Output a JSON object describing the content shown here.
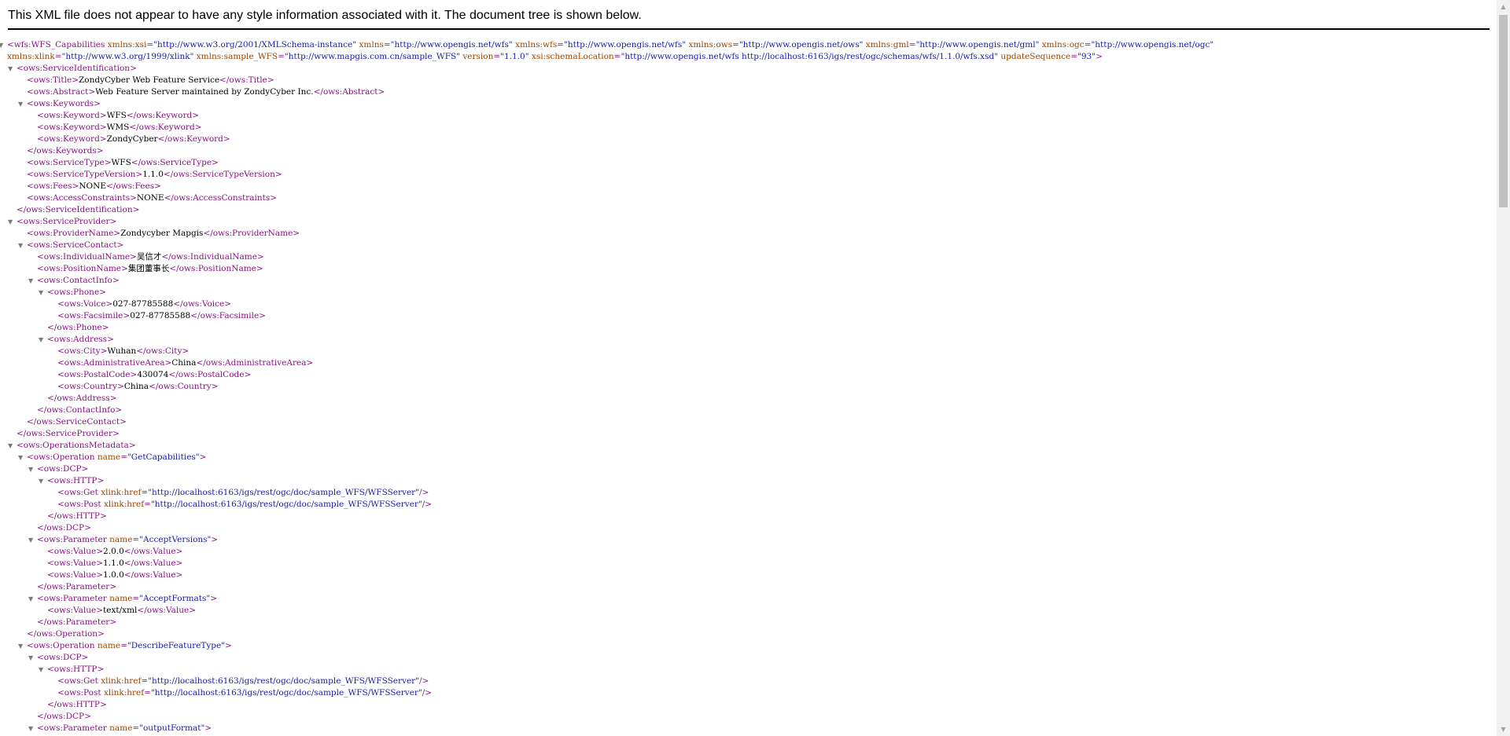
{
  "banner": {
    "text": "This XML file does not appear to have any style information associated with it. The document tree is shown below."
  },
  "icons": {
    "expand": "triangle-down-icon",
    "scroll_up": "scroll-up-arrow-icon",
    "scroll_down": "scroll-down-arrow-icon"
  },
  "scroll": {
    "position_fraction": 0.0
  },
  "colors": {
    "tag": "#881280",
    "attribute_name": "#994500",
    "attribute_value": "#1a1aa6",
    "text": "#000000"
  },
  "tree": {
    "root": {
      "open_tag": "<wfs:WFS_Capabilities",
      "attrs_line1": [
        {
          "name": "xmlns:xsi",
          "value": "\"http://www.w3.org/2001/XMLSchema-instance\""
        },
        {
          "name": "xmlns",
          "value": "\"http://www.opengis.net/wfs\""
        },
        {
          "name": "xmlns:wfs",
          "value": "\"http://www.opengis.net/wfs\""
        },
        {
          "name": "xmlns:ows",
          "value": "\"http://www.opengis.net/ows\""
        },
        {
          "name": "xmlns:gml",
          "value": "\"http://www.opengis.net/gml\""
        },
        {
          "name": "xmlns:ogc",
          "value": "\"http://www.opengis.net/ogc\""
        }
      ],
      "attrs_line2": [
        {
          "name": "xmlns:xlink",
          "value": "\"http://www.w3.org/1999/xlink\""
        },
        {
          "name": "xmlns:sample_WFS",
          "value": "\"http://www.mapgis.com.cn/sample_WFS\""
        },
        {
          "name": "version",
          "value": "\"1.1.0\""
        },
        {
          "name": "xsi:schemaLocation",
          "value": "\"http://www.opengis.net/wfs http://localhost:6163/igs/rest/ogc/schemas/wfs/1.1.0/wfs.xsd\""
        },
        {
          "name": "updateSequence",
          "value": "\"93\""
        }
      ],
      "close_bracket": ">"
    },
    "service_identification": {
      "open": "<ows:ServiceIdentification>",
      "title": {
        "open": "<ows:Title>",
        "value": "ZondyCyber Web Feature Service",
        "close": "</ows:Title>"
      },
      "abstract": {
        "open": "<ows:Abstract>",
        "value": "Web Feature Server maintained by ZondyCyber Inc.",
        "close": "</ows:Abstract>"
      },
      "keywords_open": "<ows:Keywords>",
      "keywords": [
        {
          "open": "<ows:Keyword>",
          "value": "WFS",
          "close": "</ows:Keyword>"
        },
        {
          "open": "<ows:Keyword>",
          "value": "WMS",
          "close": "</ows:Keyword>"
        },
        {
          "open": "<ows:Keyword>",
          "value": "ZondyCyber",
          "close": "</ows:Keyword>"
        }
      ],
      "keywords_close": "</ows:Keywords>",
      "service_type": {
        "open": "<ows:ServiceType>",
        "value": "WFS",
        "close": "</ows:ServiceType>"
      },
      "service_type_version": {
        "open": "<ows:ServiceTypeVersion>",
        "value": "1.1.0",
        "close": "</ows:ServiceTypeVersion>"
      },
      "fees": {
        "open": "<ows:Fees>",
        "value": "NONE",
        "close": "</ows:Fees>"
      },
      "access_constraints": {
        "open": "<ows:AccessConstraints>",
        "value": "NONE",
        "close": "</ows:AccessConstraints>"
      },
      "close": "</ows:ServiceIdentification>"
    },
    "service_provider": {
      "open": "<ows:ServiceProvider>",
      "provider_name": {
        "open": "<ows:ProviderName>",
        "value": "Zondycyber Mapgis",
        "close": "</ows:ProviderName>"
      },
      "service_contact_open": "<ows:ServiceContact>",
      "individual_name": {
        "open": "<ows:IndividualName>",
        "value": "吴信才",
        "close": "</ows:IndividualName>"
      },
      "position_name": {
        "open": "<ows:PositionName>",
        "value": "集团董事长",
        "close": "</ows:PositionName>"
      },
      "contact_info_open": "<ows:ContactInfo>",
      "phone_open": "<ows:Phone>",
      "voice": {
        "open": "<ows:Voice>",
        "value": "027-87785588",
        "close": "</ows:Voice>"
      },
      "facsimile": {
        "open": "<ows:Facsimile>",
        "value": "027-87785588",
        "close": "</ows:Facsimile>"
      },
      "phone_close": "</ows:Phone>",
      "address_open": "<ows:Address>",
      "city": {
        "open": "<ows:City>",
        "value": "Wuhan",
        "close": "</ows:City>"
      },
      "administrative_area": {
        "open": "<ows:AdministrativeArea>",
        "value": "China",
        "close": "</ows:AdministrativeArea>"
      },
      "postal_code": {
        "open": "<ows:PostalCode>",
        "value": "430074",
        "close": "</ows:PostalCode>"
      },
      "country": {
        "open": "<ows:Country>",
        "value": "China",
        "close": "</ows:Country>"
      },
      "address_close": "</ows:Address>",
      "contact_info_close": "</ows:ContactInfo>",
      "service_contact_close": "</ows:ServiceContact>",
      "close": "</ows:ServiceProvider>"
    },
    "operations_metadata": {
      "open": "<ows:OperationsMetadata>",
      "op_open_prefix": "<ows:Operation",
      "op_attr_name": "name",
      "op_close": "</ows:Operation>",
      "dcp_open": "<ows:DCP>",
      "dcp_close": "</ows:DCP>",
      "http_open": "<ows:HTTP>",
      "http_close": "</ows:HTTP>",
      "get_prefix": "<ows:Get",
      "post_prefix": "<ows:Post",
      "href_attr": "xlink:href",
      "self_close": "/>",
      "param_open_prefix": "<ows:Parameter",
      "param_attr_name": "name",
      "param_close": "</ows:Parameter>",
      "value_open": "<ows:Value>",
      "value_close": "</ows:Value>",
      "operations": [
        {
          "name": "\"GetCapabilities\"",
          "get_href": "\"http://localhost:6163/igs/rest/ogc/doc/sample_WFS/WFSServer\"",
          "post_href": "\"http://localhost:6163/igs/rest/ogc/doc/sample_WFS/WFSServer\"",
          "parameters": [
            {
              "name": "\"AcceptVersions\"",
              "values": [
                "2.0.0",
                "1.1.0",
                "1.0.0"
              ]
            },
            {
              "name": "\"AcceptFormats\"",
              "values": [
                "text/xml"
              ]
            }
          ]
        },
        {
          "name": "\"DescribeFeatureType\"",
          "get_href": "\"http://localhost:6163/igs/rest/ogc/doc/sample_WFS/WFSServer\"",
          "post_href": "\"http://localhost:6163/igs/rest/ogc/doc/sample_WFS/WFSServer\"",
          "parameters": [
            {
              "name": "\"outputFormat\"",
              "values": []
            }
          ]
        }
      ]
    }
  }
}
